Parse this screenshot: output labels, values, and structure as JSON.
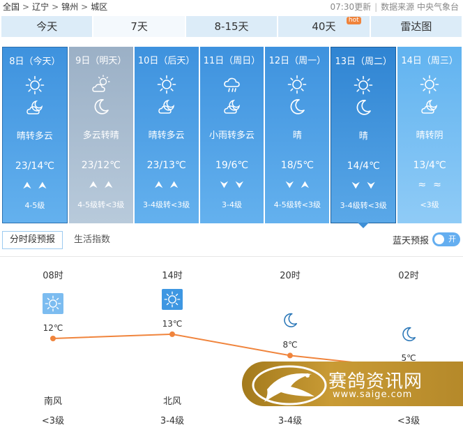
{
  "breadcrumb": {
    "items": [
      "全国",
      "辽宁",
      "锦州",
      "城区"
    ],
    "sep": ">"
  },
  "update_time": "07:30更新",
  "source": "数据来源 中央气象台",
  "tabs": [
    {
      "label": "今天"
    },
    {
      "label": "7天"
    },
    {
      "label": "8-15天"
    },
    {
      "label": "40天",
      "badge": "hot"
    },
    {
      "label": "雷达图"
    }
  ],
  "days": [
    {
      "date": "8日（今天）",
      "icon_day": "sun-icon",
      "icon_night": "cloud-moon-icon",
      "condition": "晴转多云",
      "temp": "23/14℃",
      "wind_dir": "north-arrows",
      "wind_dir_glyph": "⮝⮝",
      "wind_scale": "4-5级"
    },
    {
      "date": "9日（明天）",
      "icon_day": "partly-cloudy-icon",
      "icon_night": "moon-icon",
      "condition": "多云转晴",
      "temp": "23/12℃",
      "wind_dir": "north-arrows",
      "wind_dir_glyph": "⮝⮝",
      "wind_scale": "4-5级转<3级"
    },
    {
      "date": "10日（后天）",
      "icon_day": "sun-icon",
      "icon_night": "cloud-moon-icon",
      "condition": "晴转多云",
      "temp": "23/13℃",
      "wind_dir": "north-arrows",
      "wind_dir_glyph": "⮝⮝",
      "wind_scale": "3-4级转<3级"
    },
    {
      "date": "11日（周日）",
      "icon_day": "rain-icon",
      "icon_night": "cloud-moon-icon",
      "condition": "小雨转多云",
      "temp": "19/6℃",
      "wind_dir": "south-arrows",
      "wind_dir_glyph": "⮟⮟",
      "wind_scale": "3-4级"
    },
    {
      "date": "12日（周一）",
      "icon_day": "sun-icon",
      "icon_night": "moon-icon",
      "condition": "晴",
      "temp": "18/5℃",
      "wind_dir": "south-north-arrows",
      "wind_dir_glyph": "⮟⮝",
      "wind_scale": "4-5级转<3级"
    },
    {
      "date": "13日（周二）",
      "icon_day": "sun-icon",
      "icon_night": "moon-icon",
      "condition": "晴",
      "temp": "14/4℃",
      "wind_dir": "south-arrows",
      "wind_dir_glyph": "⮟⮟",
      "wind_scale": "3-4级转<3级"
    },
    {
      "date": "14日（周三）",
      "icon_day": "sun-icon",
      "icon_night": "cloud-moon-icon",
      "condition": "晴转阴",
      "temp": "13/4℃",
      "wind_dir": "variable-wind",
      "wind_dir_glyph": "≈≈",
      "wind_scale": "<3级"
    }
  ],
  "subtabs": [
    {
      "label": "分时段预报"
    },
    {
      "label": "生活指数"
    }
  ],
  "blue_sky": {
    "label": "蓝天预报",
    "toggle": "开"
  },
  "hourly": [
    {
      "time": "08时",
      "icon": "sun-icon",
      "temp": "12℃",
      "temp_value": 12,
      "wind_dir": "南风",
      "wind_scale": "<3级"
    },
    {
      "time": "14时",
      "icon": "sun-icon",
      "temp": "13℃",
      "temp_value": 13,
      "wind_dir": "北风",
      "wind_scale": "3-4级"
    },
    {
      "time": "20时",
      "icon": "moon-icon",
      "temp": "8℃",
      "temp_value": 8,
      "wind_dir": "",
      "wind_scale": "3-4级"
    },
    {
      "time": "02时",
      "icon": "moon-icon",
      "temp": "5℃",
      "temp_value": 5,
      "wind_dir": "",
      "wind_scale": "<3级"
    }
  ],
  "watermark": {
    "text": "赛鸽资讯网",
    "url": "www.saige.com"
  },
  "colors": {
    "accent": "#3e92de",
    "tab_bg": "#dcecf8",
    "line": "#f0843c",
    "watermark": "#b8882a"
  }
}
